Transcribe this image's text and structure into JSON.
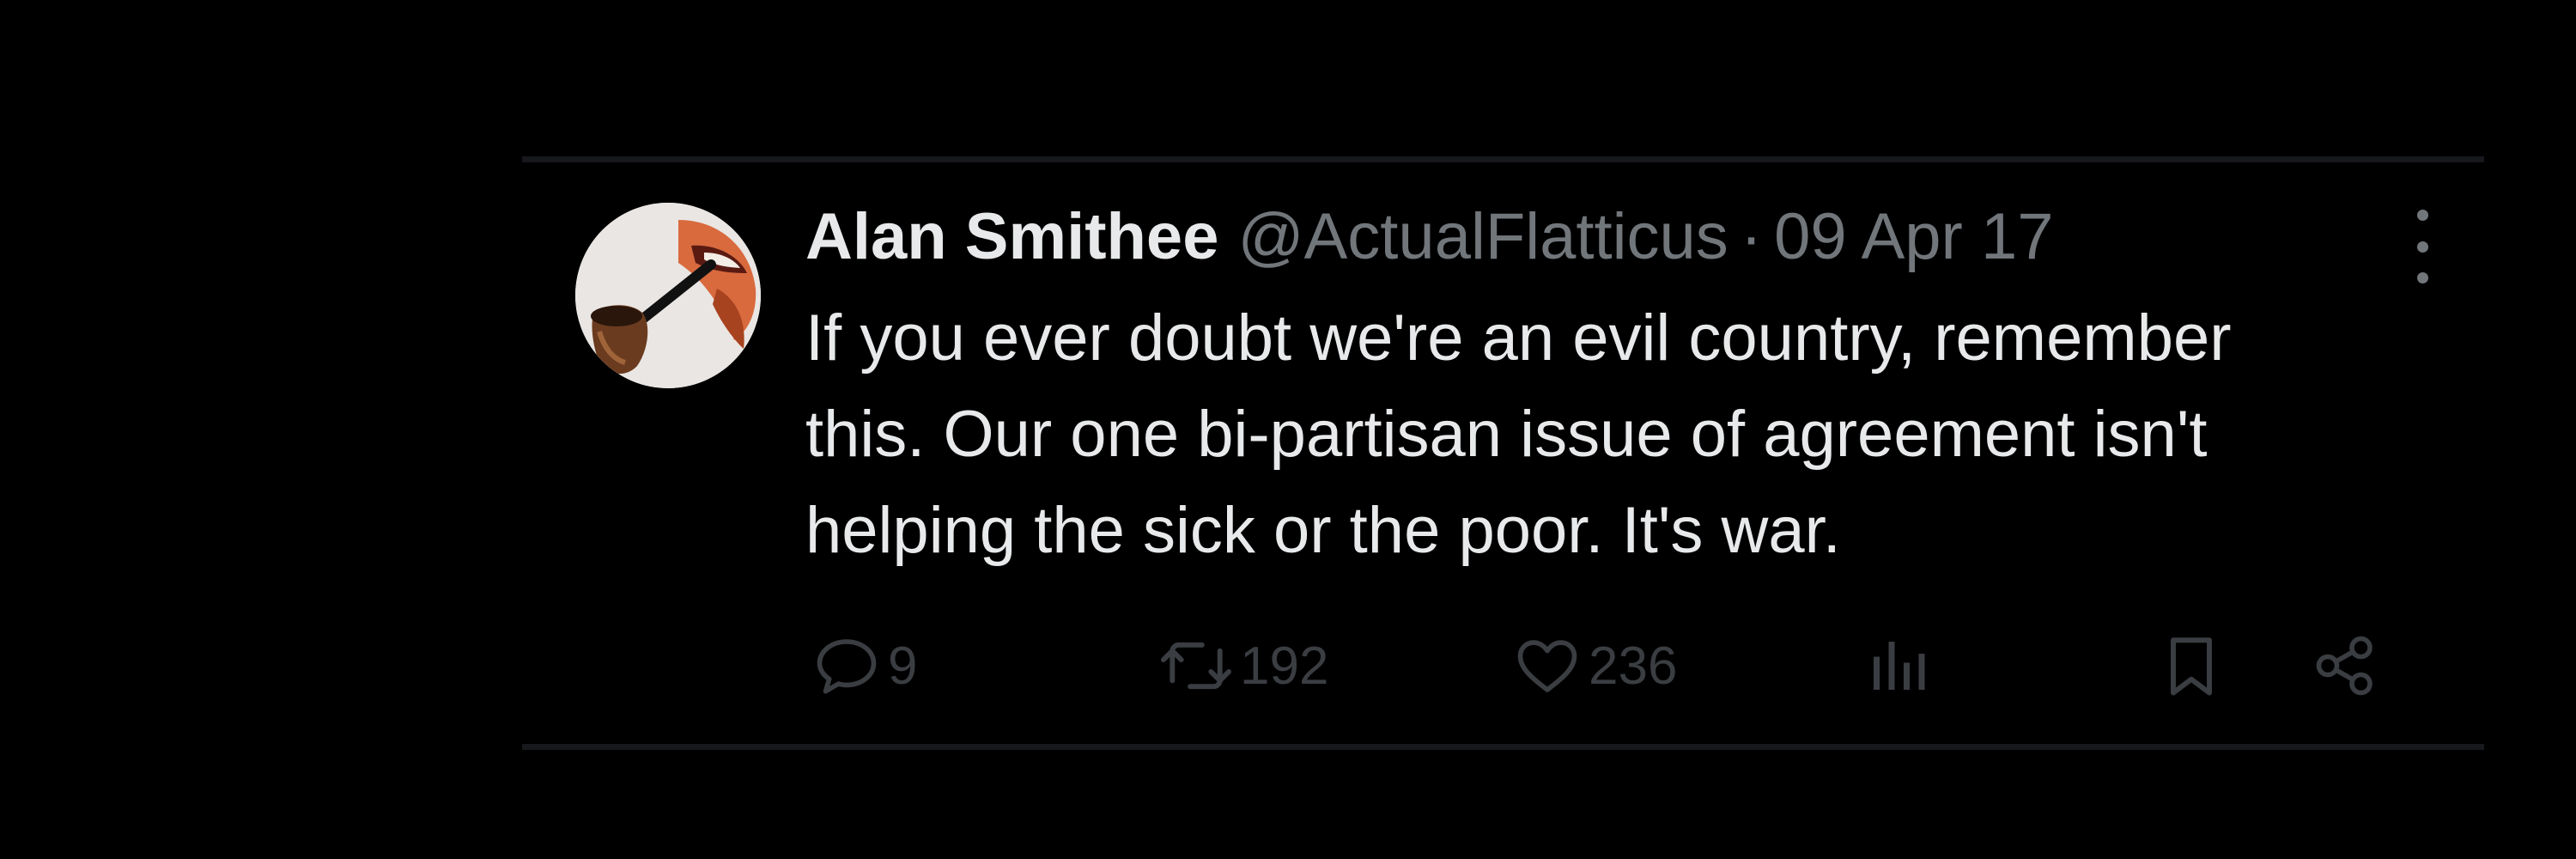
{
  "tweet": {
    "display_name": "Alan Smithee",
    "handle": "@ActualFlatticus",
    "separator": "·",
    "date": "09 Apr 17",
    "text_lines": [
      "If you ever doubt we're an evil country, remember",
      "this. Our one bi-partisan issue of agreement isn't",
      "helping the sick or the poor. It's war."
    ],
    "stats": {
      "replies": "9",
      "retweets": "192",
      "likes": "236"
    }
  },
  "icons": {
    "reply": "speech-bubble-icon",
    "retweet": "retweet-arrows-icon",
    "like": "heart-icon",
    "views": "bar-chart-icon",
    "bookmark": "bookmark-icon",
    "share": "share-nodes-icon",
    "more": "vertical-ellipsis-icon"
  },
  "colors": {
    "background": "#000000",
    "primary_text": "#e7e9ea",
    "secondary_text": "#71767b",
    "action_icons": "#3a3d41",
    "divider": "#16181c"
  }
}
